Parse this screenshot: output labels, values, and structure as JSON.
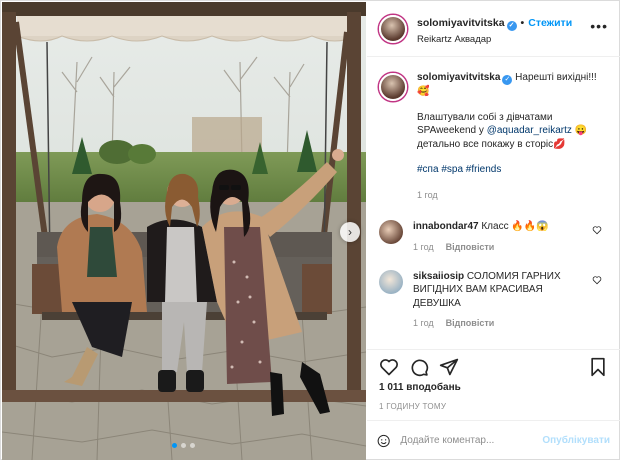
{
  "post": {
    "username": "solomiyavitvitska",
    "follow_label": "Стежити",
    "separator": "•",
    "location": "Reikartz Аквадар",
    "more_icon": "more-horizontal-icon",
    "caption": {
      "line1": "Нарешті вихідні!!!🥰",
      "line2_before": "Влаштували собі з дівчатами SPAweekend у ",
      "mention": "@aquadar_reikartz",
      "line2_after": " 😛 детально все покажу в сторіс💋",
      "hashtags": "#спа #spa #friends",
      "time": "1 год"
    },
    "comments": [
      {
        "user": "innabondar47",
        "text": "Класс 🔥🔥😱",
        "time": "1 год",
        "reply": "Відповісти"
      },
      {
        "user": "siksaiiosip",
        "text": "СОЛОМИЯ ГАРНИХ ВИГІДНИХ ВАМ КРАСИВАЯ ДЕВУШКА",
        "time": "1 год",
        "reply": "Відповісти"
      }
    ],
    "likes": "1 011 вподобань",
    "posted_ago": "1 ГОДИНУ ТОМУ",
    "comment_placeholder": "Додайте коментар...",
    "post_button": "Опублікувати",
    "carousel": {
      "index": 1,
      "count": 3
    }
  },
  "colors": {
    "accent": "#0095f6",
    "link": "#00376b",
    "muted": "#8e8e8e",
    "border": "#dbdbdb"
  }
}
